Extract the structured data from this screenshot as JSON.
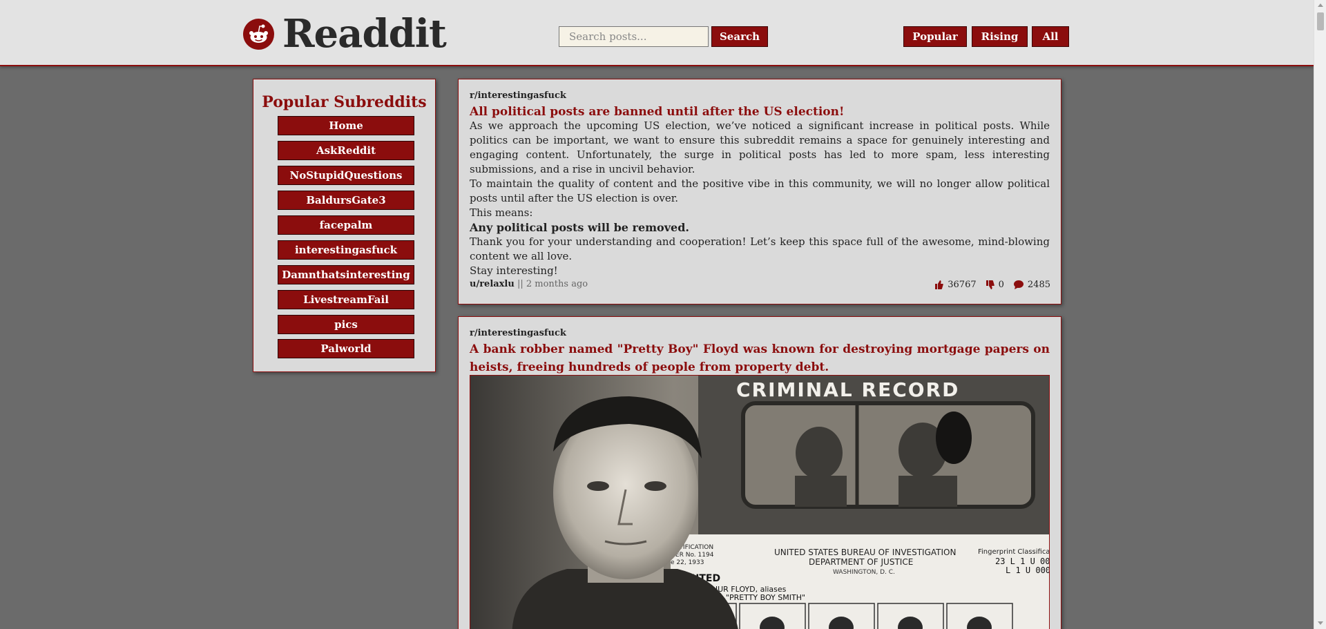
{
  "app": {
    "name": "Readdit",
    "colors": {
      "accent": "#8b0d0d",
      "header_bg": "#e3e3e3",
      "page_bg": "#6b6b6b",
      "card_bg": "#dadada"
    }
  },
  "header": {
    "search_placeholder": "Search posts...",
    "search_button": "Search",
    "nav": [
      "Popular",
      "Rising",
      "All"
    ]
  },
  "sidebar": {
    "title": "Popular Subreddits",
    "items": [
      "Home",
      "AskReddit",
      "NoStupidQuestions",
      "BaldursGate3",
      "facepalm",
      "interestingasfuck",
      "Damnthatsinteresting",
      "LivestreamFail",
      "pics",
      "Palworld"
    ]
  },
  "posts": [
    {
      "subreddit": "r/interestingasfuck",
      "title": "All political posts are banned until after the US election!",
      "body": [
        "As we approach the upcoming US election, we’ve noticed a significant increase in political posts. While politics can be important, we want to ensure this subreddit remains a space for genuinely interesting and engaging content. Unfortunately, the surge in political posts has led to more spam, less interesting submissions, and a rise in uncivil behavior.",
        "To maintain the quality of content and the positive vibe in this community, we will no longer allow political posts until after the US election is over.",
        "This means:",
        "Any political posts will be removed.",
        "Thank you for your understanding and cooperation! Let’s keep this space full of the awesome, mind-blowing content we all love.",
        "Stay interesting!"
      ],
      "author": "u/relaxlu",
      "separator": "||",
      "time": "2 months ago",
      "upvotes": "36767",
      "downvotes": "0",
      "comments": "2485"
    },
    {
      "subreddit": "r/interestingasfuck",
      "title": "A bank robber named \"Pretty Boy\" Floyd was known for destroying mortgage papers on heists, freeing hundreds of people from property debt.",
      "image": {
        "criminal_record": "CRIMINAL RECORD",
        "bureau_line1": "UNITED STATES BUREAU OF INVESTIGATION",
        "bureau_line2": "DEPARTMENT OF JUSTICE",
        "bureau_line3": "WASHINGTON, D. C.",
        "wanted": "WANTED",
        "name_line1": "ARLES ARTHUR FLOYD, aliases",
        "name_line2": "NK MITCHELL, \"PRETTY BOY SMITH\"",
        "id_line1": "ENTIFICATION",
        "id_line2": "DER No. 1194",
        "id_line3": "e 22, 1933",
        "fp_title": "Fingerprint Classificat",
        "fp_line1": "23 L 1 U 000",
        "fp_line2": "L 1 U 000"
      }
    }
  ]
}
